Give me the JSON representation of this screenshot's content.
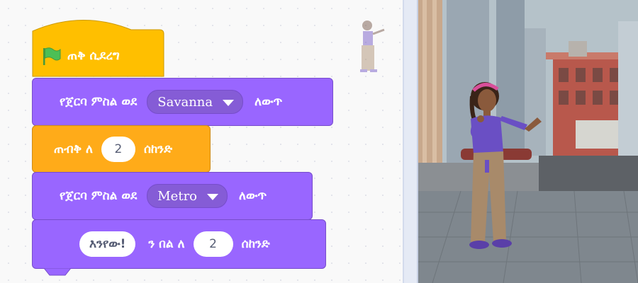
{
  "hat_block": {
    "label": "ጠቅ ሲደረግ",
    "color": "#ffbf00"
  },
  "switch_costume_1": {
    "prefix": "የጀርባ ምስል ወደ",
    "value": "Savanna",
    "suffix": "ለውጥ"
  },
  "wait_block": {
    "prefix": "ጠብቅ ለ",
    "value": "2",
    "suffix": "ሰከንድ"
  },
  "switch_costume_2": {
    "prefix": "የጀርባ ምስል ወደ",
    "value": "Metro",
    "suffix": "ለውጥ"
  },
  "say_block": {
    "message": "እንየው!",
    "middle": "ን በል ለ",
    "value": "2",
    "suffix": "ሰከንድ"
  },
  "colors": {
    "looks": "#9966ff",
    "control": "#ffab19",
    "events": "#ffbf00"
  },
  "icons": {
    "flag": "green-flag-icon",
    "dropdown": "dropdown-arrow-icon"
  }
}
